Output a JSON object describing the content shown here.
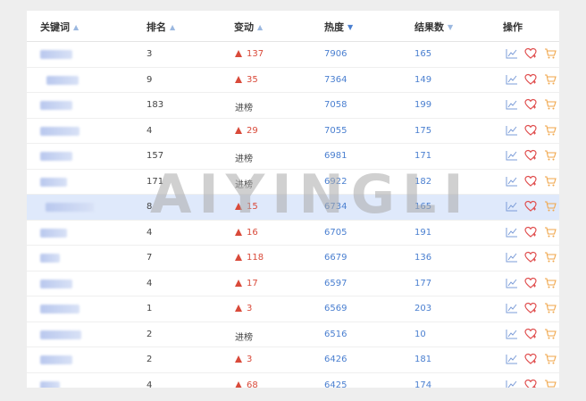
{
  "columns": [
    {
      "label": "关键词",
      "sort": "up"
    },
    {
      "label": "排名",
      "sort": "up"
    },
    {
      "label": "变动",
      "sort": "up"
    },
    {
      "label": "热度",
      "sort": "down"
    },
    {
      "label": "结果数",
      "sort": "down-light"
    },
    {
      "label": "操作",
      "sort": ""
    }
  ],
  "rows": [
    {
      "rank": "3",
      "change": "137",
      "change_type": "up",
      "heat": "7906",
      "results": "165"
    },
    {
      "rank": "9",
      "change": "35",
      "change_type": "up",
      "heat": "7364",
      "results": "149"
    },
    {
      "rank": "183",
      "change": "进榜",
      "change_type": "new",
      "heat": "7058",
      "results": "199"
    },
    {
      "rank": "4",
      "change": "29",
      "change_type": "up",
      "heat": "7055",
      "results": "175"
    },
    {
      "rank": "157",
      "change": "进榜",
      "change_type": "new",
      "heat": "6981",
      "results": "171"
    },
    {
      "rank": "171",
      "change": "进榜",
      "change_type": "new",
      "heat": "6922",
      "results": "182"
    },
    {
      "rank": "8",
      "change": "15",
      "change_type": "up",
      "heat": "6734",
      "results": "165",
      "highlighted": true
    },
    {
      "rank": "4",
      "change": "16",
      "change_type": "up",
      "heat": "6705",
      "results": "191"
    },
    {
      "rank": "7",
      "change": "118",
      "change_type": "up",
      "heat": "6679",
      "results": "136"
    },
    {
      "rank": "4",
      "change": "17",
      "change_type": "up",
      "heat": "6597",
      "results": "177"
    },
    {
      "rank": "1",
      "change": "3",
      "change_type": "up",
      "heat": "6569",
      "results": "203"
    },
    {
      "rank": "2",
      "change": "进榜",
      "change_type": "new",
      "heat": "6516",
      "results": "10"
    },
    {
      "rank": "2",
      "change": "3",
      "change_type": "up",
      "heat": "6426",
      "results": "181"
    },
    {
      "rank": "4",
      "change": "68",
      "change_type": "up",
      "heat": "6425",
      "results": "174"
    }
  ],
  "row_actions": [
    "trend-icon",
    "heart-icon",
    "cart-icon"
  ],
  "watermark": "AIYINGLI",
  "colors": {
    "up": "#d94a3a",
    "link": "#4a7fd0",
    "cart": "#f0a64a",
    "heart": "#e05050",
    "highlight": "#dfe9fb"
  }
}
